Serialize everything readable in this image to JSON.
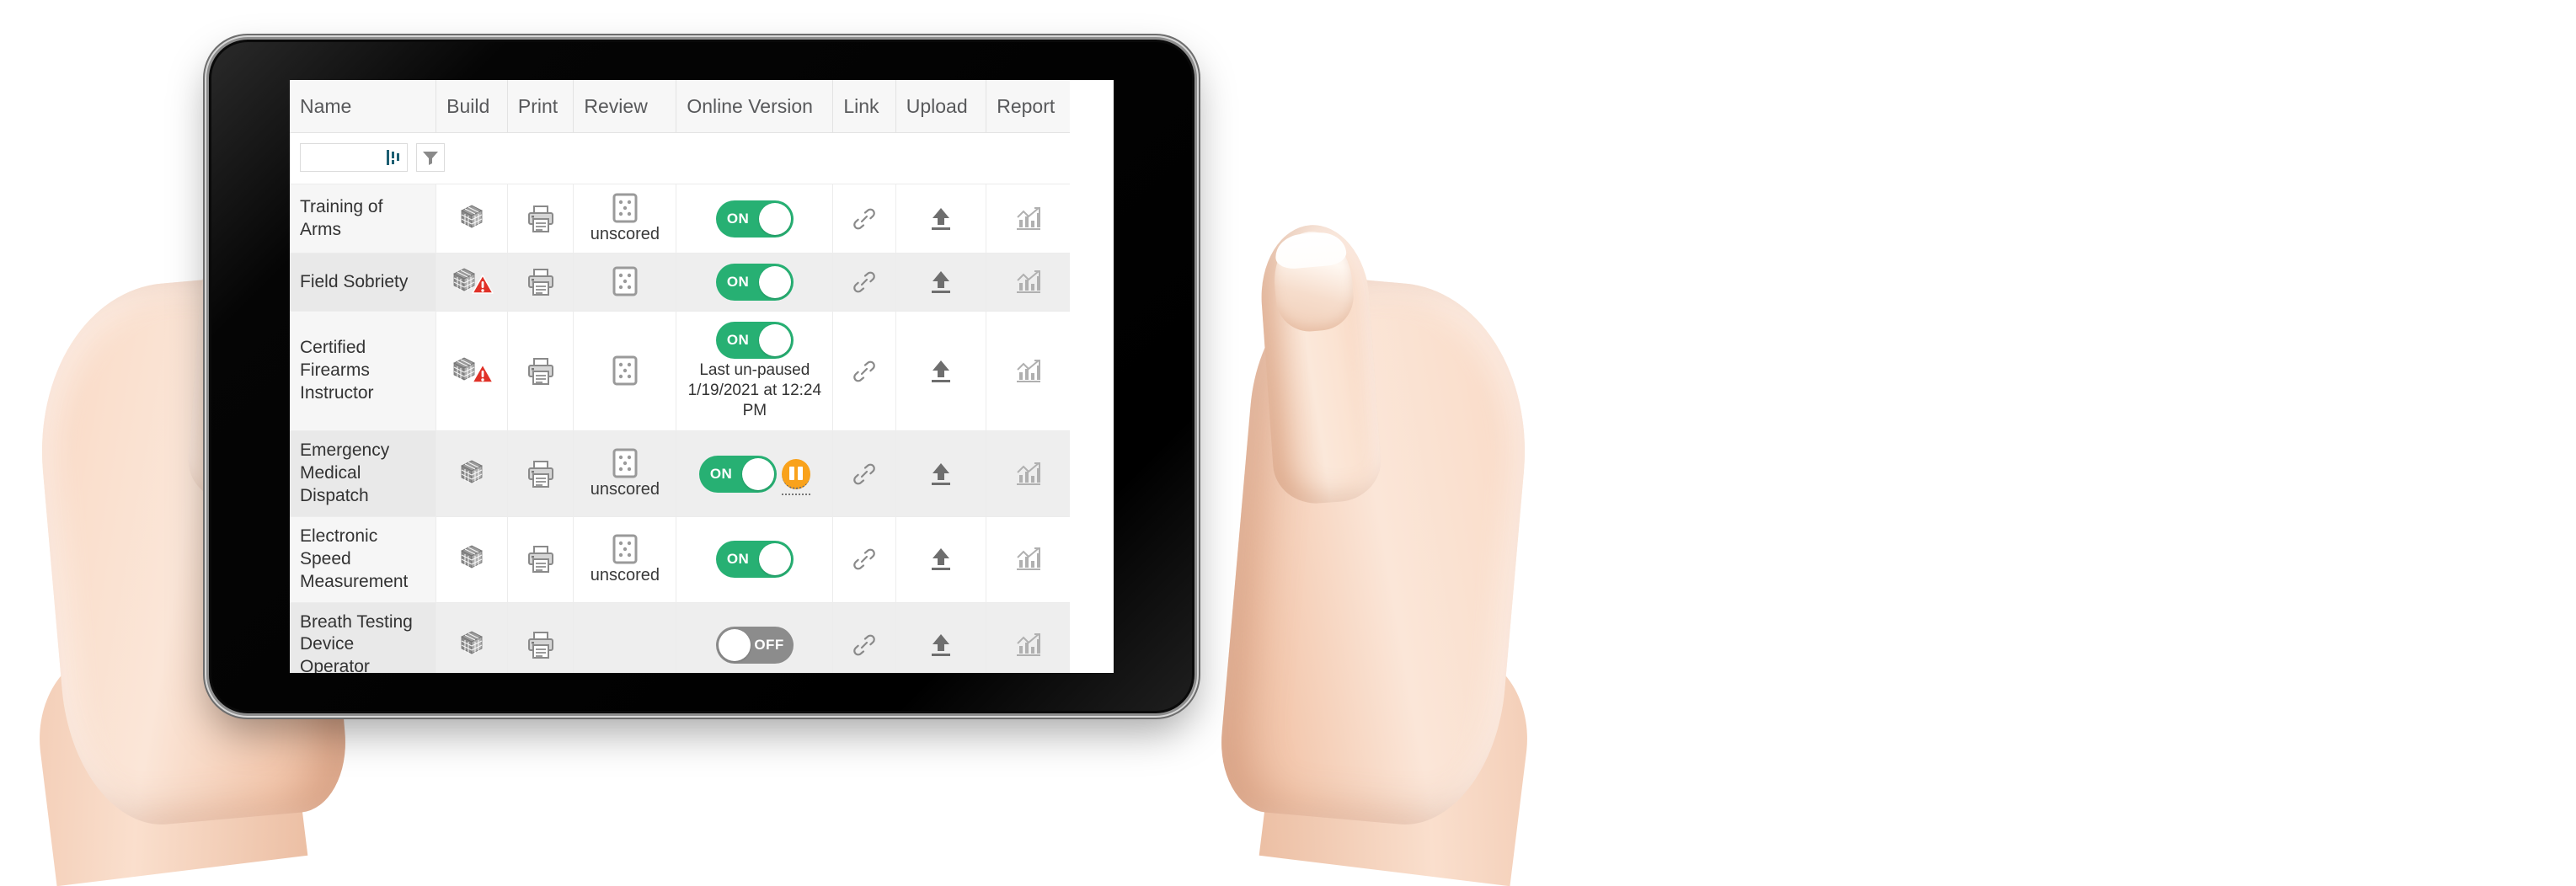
{
  "device": {
    "type": "tablet",
    "frame_color": "#0a0a0a"
  },
  "table": {
    "columns": [
      {
        "key": "name",
        "label": "Name"
      },
      {
        "key": "build",
        "label": "Build"
      },
      {
        "key": "print",
        "label": "Print"
      },
      {
        "key": "review",
        "label": "Review"
      },
      {
        "key": "online",
        "label": "Online Version"
      },
      {
        "key": "link",
        "label": "Link"
      },
      {
        "key": "upload",
        "label": "Upload"
      },
      {
        "key": "report",
        "label": "Report"
      }
    ],
    "filter": {
      "input_value": "",
      "input_placeholder": "",
      "columns_icon": "columns-icon",
      "filter_icon": "funnel-icon"
    },
    "icons": {
      "build": "cube-icon",
      "build_warning": "warning-triangle-icon",
      "print": "printer-icon",
      "review": "score-card-icon",
      "link": "chain-link-icon",
      "upload": "upload-arrow-icon",
      "report": "bar-chart-icon",
      "pause": "pause-icon"
    },
    "toggle_labels": {
      "on": "ON",
      "off": "OFF"
    },
    "rows": [
      {
        "name": "Training of Arms",
        "build_warning": false,
        "has_print": true,
        "has_review": true,
        "review_label": "unscored",
        "online_state": "ON",
        "online_note": "",
        "has_pause": false,
        "has_link": true,
        "has_upload": true,
        "has_report": true,
        "striped": false
      },
      {
        "name": "Field Sobriety",
        "build_warning": true,
        "has_print": true,
        "has_review": true,
        "review_label": "",
        "online_state": "ON",
        "online_note": "",
        "has_pause": false,
        "has_link": true,
        "has_upload": true,
        "has_report": true,
        "striped": true
      },
      {
        "name": "Certified Firearms Instructor",
        "build_warning": true,
        "has_print": true,
        "has_review": true,
        "review_label": "",
        "online_state": "ON",
        "online_note": "Last un-paused 1/19/2021 at 12:24 PM",
        "has_pause": false,
        "has_link": true,
        "has_upload": true,
        "has_report": true,
        "striped": false
      },
      {
        "name": "Emergency Medical Dispatch",
        "build_warning": false,
        "has_print": true,
        "has_review": true,
        "review_label": "unscored",
        "online_state": "ON",
        "online_note": "",
        "has_pause": true,
        "has_link": true,
        "has_upload": true,
        "has_report": true,
        "striped": true
      },
      {
        "name": "Electronic Speed Measurement",
        "build_warning": false,
        "has_print": true,
        "has_review": true,
        "review_label": "unscored",
        "online_state": "ON",
        "online_note": "",
        "has_pause": false,
        "has_link": true,
        "has_upload": true,
        "has_report": true,
        "striped": false
      },
      {
        "name": "Breath Testing Device Operator",
        "build_warning": false,
        "has_print": true,
        "has_review": false,
        "review_label": "",
        "online_state": "OFF",
        "online_note": "",
        "has_pause": false,
        "has_link": true,
        "has_upload": true,
        "has_report": true,
        "striped": true
      }
    ]
  },
  "colors": {
    "toggle_on": "#27b073",
    "toggle_off": "#8c8c8c",
    "pause": "#f9a21b",
    "warning": "#e03127",
    "header_text": "#58595b",
    "accent_filter": "#1d5f72"
  }
}
